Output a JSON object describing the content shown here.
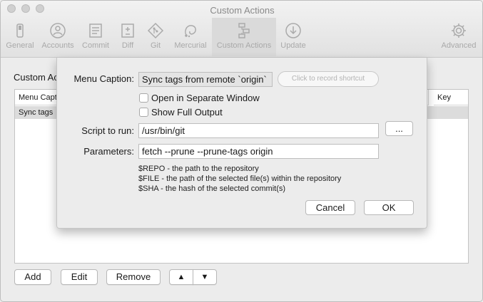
{
  "window": {
    "title": "Custom Actions"
  },
  "toolbar": {
    "items": [
      {
        "label": "General",
        "icon": "switch-icon"
      },
      {
        "label": "Accounts",
        "icon": "person-icon"
      },
      {
        "label": "Commit",
        "icon": "document-icon"
      },
      {
        "label": "Diff",
        "icon": "diff-icon"
      },
      {
        "label": "Git",
        "icon": "git-diamond-icon"
      },
      {
        "label": "Mercurial",
        "icon": "mercurial-icon"
      },
      {
        "label": "Custom Actions",
        "icon": "flowchart-icon",
        "active": true
      },
      {
        "label": "Update",
        "icon": "download-icon"
      },
      {
        "label": "Advanced",
        "icon": "gear-icon"
      }
    ]
  },
  "main": {
    "heading": "Custom Ac",
    "table": {
      "columns": [
        "Menu Capt",
        "Key"
      ],
      "rows": [
        {
          "caption": "Sync tags"
        }
      ]
    },
    "buttons": {
      "add": "Add",
      "edit": "Edit",
      "remove": "Remove",
      "up": "▲",
      "down": "▼"
    }
  },
  "sheet": {
    "caption_label": "Menu Caption:",
    "caption_value": "Sync tags from remote `origin`",
    "shortcut_placeholder": "Click to record shortcut",
    "open_separate_label": "Open in Separate Window",
    "open_separate_checked": false,
    "show_full_output_label": "Show Full Output",
    "show_full_output_checked": false,
    "script_label": "Script to run:",
    "script_value": "/usr/bin/git",
    "browse_label": "...",
    "params_label": "Parameters:",
    "params_value": "fetch --prune --prune-tags origin",
    "help": [
      "$REPO - the path to the repository",
      "$FILE - the path of the selected file(s) within the repository",
      "$SHA - the hash of the selected commit(s)"
    ],
    "cancel_label": "Cancel",
    "ok_label": "OK"
  }
}
